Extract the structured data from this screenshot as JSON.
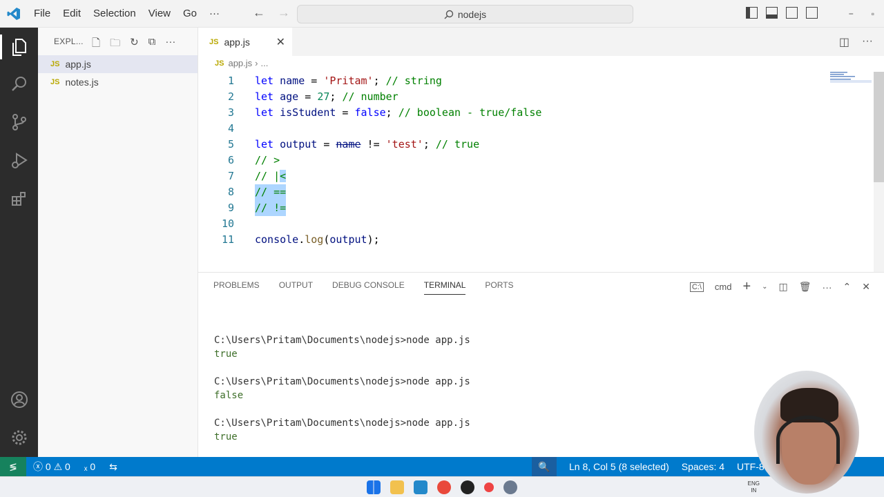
{
  "app": {
    "menu": [
      "File",
      "Edit",
      "Selection",
      "View",
      "Go",
      "···"
    ],
    "search_text": "nodejs",
    "accent": "#007acc"
  },
  "explorer": {
    "title": "EXPL...",
    "files": [
      {
        "name": "app.js",
        "badge": "JS"
      },
      {
        "name": "notes.js",
        "badge": "JS"
      }
    ]
  },
  "editor": {
    "tab_label": "app.js",
    "tab_badge": "JS",
    "breadcrumb": {
      "badge": "JS",
      "file": "app.js",
      "more": "..."
    },
    "lines": [
      {
        "n": "1",
        "text": "let name = 'Pritam'; // string"
      },
      {
        "n": "2",
        "text": "let age = 27; // number"
      },
      {
        "n": "3",
        "text": "let isStudent = false; // boolean - true/false"
      },
      {
        "n": "4",
        "text": ""
      },
      {
        "n": "5",
        "text": "let output = name != 'test'; // true"
      },
      {
        "n": "6",
        "text": "// >"
      },
      {
        "n": "7",
        "text": "// <"
      },
      {
        "n": "8",
        "text": "// =="
      },
      {
        "n": "9",
        "text": "// !="
      },
      {
        "n": "10",
        "text": ""
      },
      {
        "n": "11",
        "text": "console.log(output);"
      }
    ]
  },
  "panel": {
    "tabs": [
      "PROBLEMS",
      "OUTPUT",
      "DEBUG CONSOLE",
      "TERMINAL",
      "PORTS"
    ],
    "active_tab": "TERMINAL",
    "shell": "cmd",
    "terminal_lines": [
      {
        "text": "",
        "type": "blank"
      },
      {
        "text": "C:\\Users\\Pritam\\Documents\\nodejs>node app.js",
        "type": "cmd"
      },
      {
        "text": "true",
        "type": "out"
      },
      {
        "text": "",
        "type": "blank"
      },
      {
        "text": "C:\\Users\\Pritam\\Documents\\nodejs>node app.js",
        "type": "cmd"
      },
      {
        "text": "false",
        "type": "out"
      },
      {
        "text": "",
        "type": "blank"
      },
      {
        "text": "C:\\Users\\Pritam\\Documents\\nodejs>node app.js",
        "type": "cmd"
      },
      {
        "text": "true",
        "type": "out"
      },
      {
        "text": "",
        "type": "blank"
      }
    ],
    "prompt": "C:\\Users\\Pritam\\Documents\\nodejs>"
  },
  "status": {
    "errors": "0",
    "warnings": "0",
    "ports": "0",
    "position": "Ln 8, Col 5 (8 selected)",
    "spaces": "Spaces: 4",
    "encoding": "UTF-8",
    "eol": "C"
  },
  "taskbar": {
    "lang": "ENG",
    "region": "IN"
  }
}
